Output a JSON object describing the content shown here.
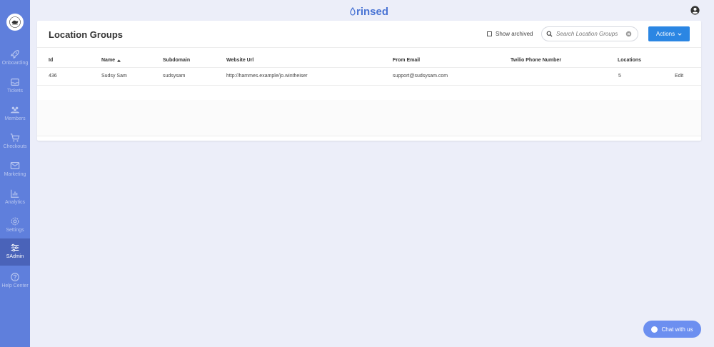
{
  "app": {
    "brand": "rinsed",
    "brand_color": "#4a74d4",
    "accent": "#2b86e3",
    "sidebar_color": "#5f7fdc"
  },
  "sidebar": {
    "items": [
      {
        "label": "Onboarding",
        "icon": "rocket-icon"
      },
      {
        "label": "Tickets",
        "icon": "ticket-icon"
      },
      {
        "label": "Members",
        "icon": "members-icon"
      },
      {
        "label": "Checkouts",
        "icon": "cart-icon"
      },
      {
        "label": "Marketing",
        "icon": "marketing-icon"
      },
      {
        "label": "Analytics",
        "icon": "chart-icon"
      },
      {
        "label": "Settings",
        "icon": "gear-icon"
      },
      {
        "label": "SAdmin",
        "icon": "sliders-icon",
        "active": true
      },
      {
        "label": "Help Center",
        "icon": "help-icon"
      }
    ]
  },
  "page": {
    "title": "Location Groups",
    "show_archived_label": "Show archived",
    "search_placeholder": "Search Location Groups",
    "actions_label": "Actions"
  },
  "table": {
    "headers": [
      "Id",
      "Name",
      "Subdomain",
      "Website Url",
      "From Email",
      "Twilio Phone Number",
      "Locations"
    ],
    "rows": [
      {
        "id": "436",
        "name": "Sudsy Sam",
        "subdomain": "sudsysam",
        "website": "http://hammes.example/jo.wintheiser",
        "email": "support@sudsysam.com",
        "phone": "",
        "locations": "5",
        "edit": "Edit"
      }
    ]
  },
  "chat": {
    "label": "Chat with us"
  }
}
